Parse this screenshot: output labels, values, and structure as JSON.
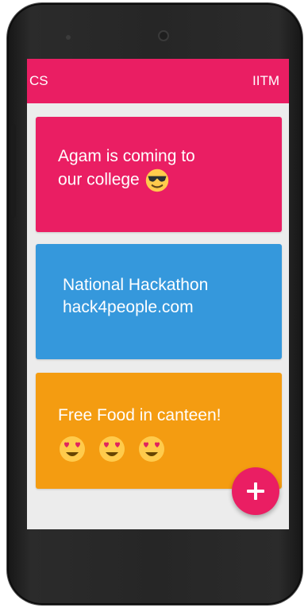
{
  "app_bar": {
    "left_title": "CS",
    "right_title": "IITM"
  },
  "cards": [
    {
      "lines": [
        "Agam is coming to",
        "our college"
      ],
      "emojis": [
        "smiling-face-with-sunglasses-icon"
      ],
      "color": "#ea1e63"
    },
    {
      "lines": [
        "National Hackathon",
        "hack4people.com"
      ],
      "color": "#3598dc"
    },
    {
      "lines": [
        "Free Food in canteen!"
      ],
      "emojis": [
        "heart-eyes-icon",
        "heart-eyes-icon",
        "heart-eyes-icon"
      ],
      "color": "#f49c11"
    }
  ],
  "fab": {
    "icon": "plus-icon",
    "color": "#ea1e63"
  },
  "colors": {
    "primary": "#ea1e63",
    "background": "#ececec"
  }
}
